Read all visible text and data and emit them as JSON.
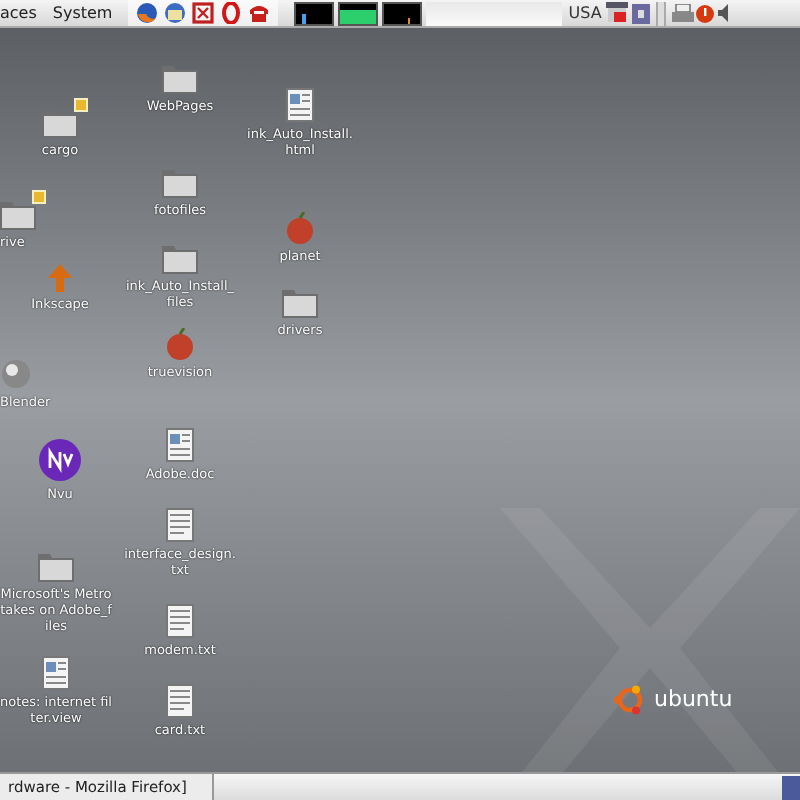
{
  "top_panel": {
    "menus": [
      "aces",
      "System"
    ],
    "keyboard_layout": "USA"
  },
  "desktop": {
    "icons": [
      {
        "label": "cargo",
        "kind": "folder",
        "emblem": true
      },
      {
        "label": "rive",
        "kind": "folder",
        "emblem": true
      },
      {
        "label": "Inkscape",
        "kind": "inkscape",
        "emblem": false
      },
      {
        "label": "Blender",
        "kind": "blender",
        "emblem": false
      },
      {
        "label": "Nvu",
        "kind": "nvu",
        "emblem": false
      },
      {
        "label": "Microsoft's Metro takes on Adobe_files",
        "kind": "folder",
        "emblem": false
      },
      {
        "label": "notes: internet filter.view",
        "kind": "document",
        "emblem": false
      },
      {
        "label": "WebPages",
        "kind": "folder",
        "emblem": false
      },
      {
        "label": "fotofiles",
        "kind": "folder",
        "emblem": false
      },
      {
        "label": "ink_Auto_Install_files",
        "kind": "folder",
        "emblem": false
      },
      {
        "label": "truevision",
        "kind": "apple",
        "emblem": false
      },
      {
        "label": "Adobe.doc",
        "kind": "document",
        "emblem": false
      },
      {
        "label": "interface_design.txt",
        "kind": "text",
        "emblem": false
      },
      {
        "label": "modem.txt",
        "kind": "text",
        "emblem": false
      },
      {
        "label": "card.txt",
        "kind": "text",
        "emblem": false
      },
      {
        "label": "ink_Auto_Install.html",
        "kind": "document",
        "emblem": false
      },
      {
        "label": "planet",
        "kind": "apple",
        "emblem": false
      },
      {
        "label": "drivers",
        "kind": "folder",
        "emblem": false
      }
    ],
    "wallpaper_logo": "ubuntu"
  },
  "taskbar": {
    "windows": [
      {
        "title": "rdware - Mozilla Firefox]",
        "selected": false
      }
    ]
  }
}
